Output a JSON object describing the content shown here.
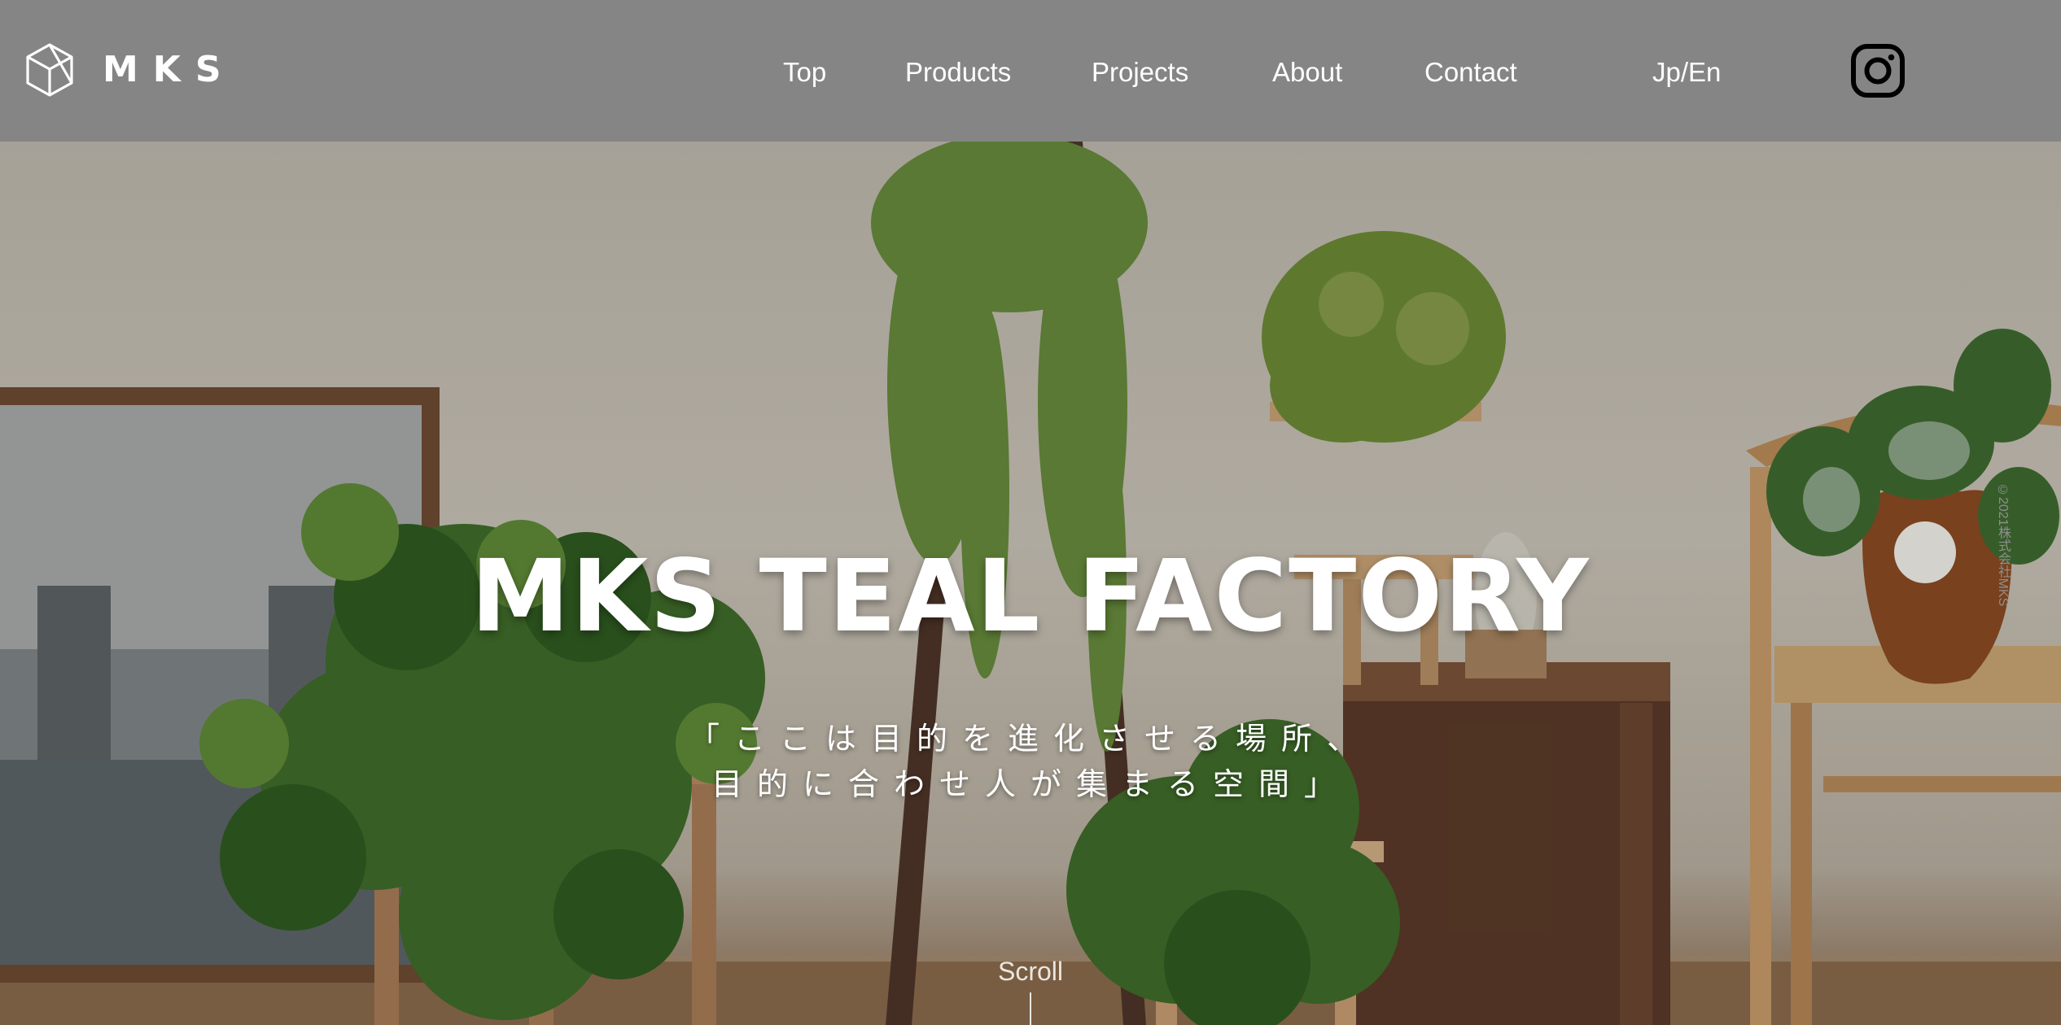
{
  "header": {
    "logo_text": "MKS",
    "logo_icon": "cube-icon",
    "nav": [
      {
        "label": "Top"
      },
      {
        "label": "Products"
      },
      {
        "label": "Projects"
      },
      {
        "label": "About"
      },
      {
        "label": "Contact"
      }
    ],
    "language_label": "Jp/En",
    "social_icon": "instagram-icon"
  },
  "hero": {
    "title": "MKS TEAL FACTORY",
    "subtitle_line1": "「ここは目的を進化させる場所、",
    "subtitle_line2": "目的に合わせ人が集まる空間」",
    "scroll_label": "Scroll",
    "copyright": "©2021株式会社MKS"
  },
  "colors": {
    "header_bg": "#858585",
    "text": "#ffffff"
  }
}
